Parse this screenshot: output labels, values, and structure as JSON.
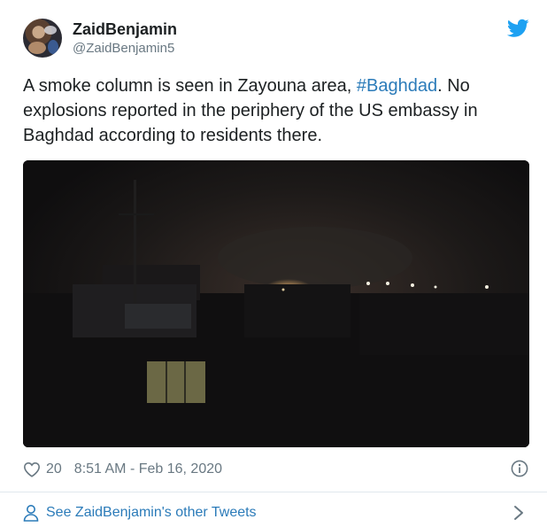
{
  "user": {
    "display_name": "ZaidBenjamin",
    "handle": "@ZaidBenjamin5"
  },
  "tweet": {
    "text_before": "A smoke column is seen in Zayouna area, ",
    "hashtag": "#Baghdad",
    "text_after": ". No\nexplosions reported in the periphery of the US embassy in\nBaghdad according to residents there."
  },
  "footer": {
    "likes": "20",
    "timestamp": "8:51 AM - Feb 16, 2020"
  },
  "link": {
    "see_more": "See ZaidBenjamin's other Tweets"
  },
  "icons": {
    "bird": "twitter-bird-icon",
    "like": "heart-icon",
    "info": "info-icon",
    "person": "person-icon",
    "chevron": "chevron-right-icon"
  },
  "colors": {
    "brand": "#1da1f2",
    "link": "#2b7bb9",
    "muted": "#697882",
    "text": "#1c2022"
  }
}
